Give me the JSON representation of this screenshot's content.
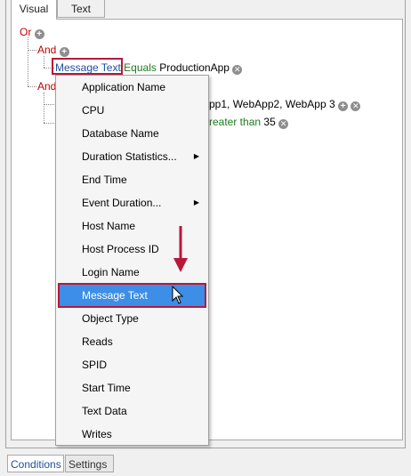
{
  "top_tabs": {
    "visual": "Visual",
    "text": "Text"
  },
  "tree": {
    "root_op": "Or",
    "group1_op": "And",
    "group1_field": "Message Text",
    "group1_condition": "Equals",
    "group1_value": "ProductionApp",
    "group2_op": "And",
    "group2_value_partial": "pp1, WebApp2, WebApp 3",
    "group2_cond_partial": "reater than",
    "group2_cond_value": "35"
  },
  "menu": {
    "items": [
      {
        "label": "Application Name",
        "submenu": false
      },
      {
        "label": "CPU",
        "submenu": false
      },
      {
        "label": "Database Name",
        "submenu": false
      },
      {
        "label": "Duration Statistics...",
        "submenu": true
      },
      {
        "label": "End Time",
        "submenu": false
      },
      {
        "label": "Event Duration...",
        "submenu": true
      },
      {
        "label": "Host Name",
        "submenu": false
      },
      {
        "label": "Host Process ID",
        "submenu": false
      },
      {
        "label": "Login Name",
        "submenu": false
      },
      {
        "label": "Message Text",
        "submenu": false,
        "selected": true
      },
      {
        "label": "Object Type",
        "submenu": false
      },
      {
        "label": "Reads",
        "submenu": false
      },
      {
        "label": "SPID",
        "submenu": false
      },
      {
        "label": "Start Time",
        "submenu": false
      },
      {
        "label": "Text Data",
        "submenu": false
      },
      {
        "label": "Writes",
        "submenu": false
      }
    ]
  },
  "bottom_tabs": {
    "conditions": "Conditions",
    "settings": "Settings"
  },
  "colors": {
    "operator": "#c00000",
    "condition": "#1e7b1e",
    "field": "#1f4fa0",
    "selection": "#3d8ee6",
    "callout": "#b8183a"
  },
  "icons": {
    "add": "plus-circle-icon",
    "remove": "x-circle-icon",
    "submenu": "triangle-right-icon",
    "pointer": "mouse-cursor-icon",
    "callout": "red-down-arrow-icon"
  }
}
